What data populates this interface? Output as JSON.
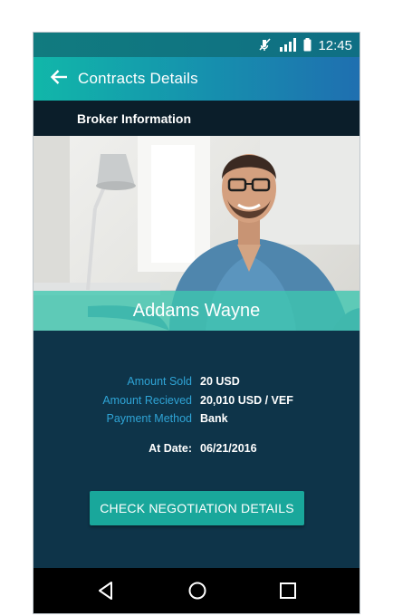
{
  "status_bar": {
    "time": "12:45",
    "icons": [
      "mute-icon",
      "signal-icon",
      "battery-icon"
    ]
  },
  "app_bar": {
    "title": "Contracts Details",
    "back_icon": "arrow-left-icon"
  },
  "section": {
    "title": "Broker Information"
  },
  "broker": {
    "name": "Addams Wayne",
    "photo": "broker-photo"
  },
  "details": {
    "amount_sold_label": "Amount Sold",
    "amount_sold_value": "20 USD",
    "amount_received_label": "Amount Recieved",
    "amount_received_value": "20,010 USD / VEF",
    "payment_method_label": "Payment Method",
    "payment_method_value": "Bank",
    "at_date_label": "At Date:",
    "at_date_value": "06/21/2016"
  },
  "actions": {
    "check_negotiation_label": "CHECK NEGOTIATION DETAILS"
  },
  "nav": {
    "back": "nav-back-icon",
    "home": "nav-home-icon",
    "recents": "nav-recents-icon"
  },
  "colors": {
    "accent": "#19a79b",
    "background": "#0e3449",
    "label": "#2fa4d6",
    "header_dark": "#0b1e2a"
  }
}
